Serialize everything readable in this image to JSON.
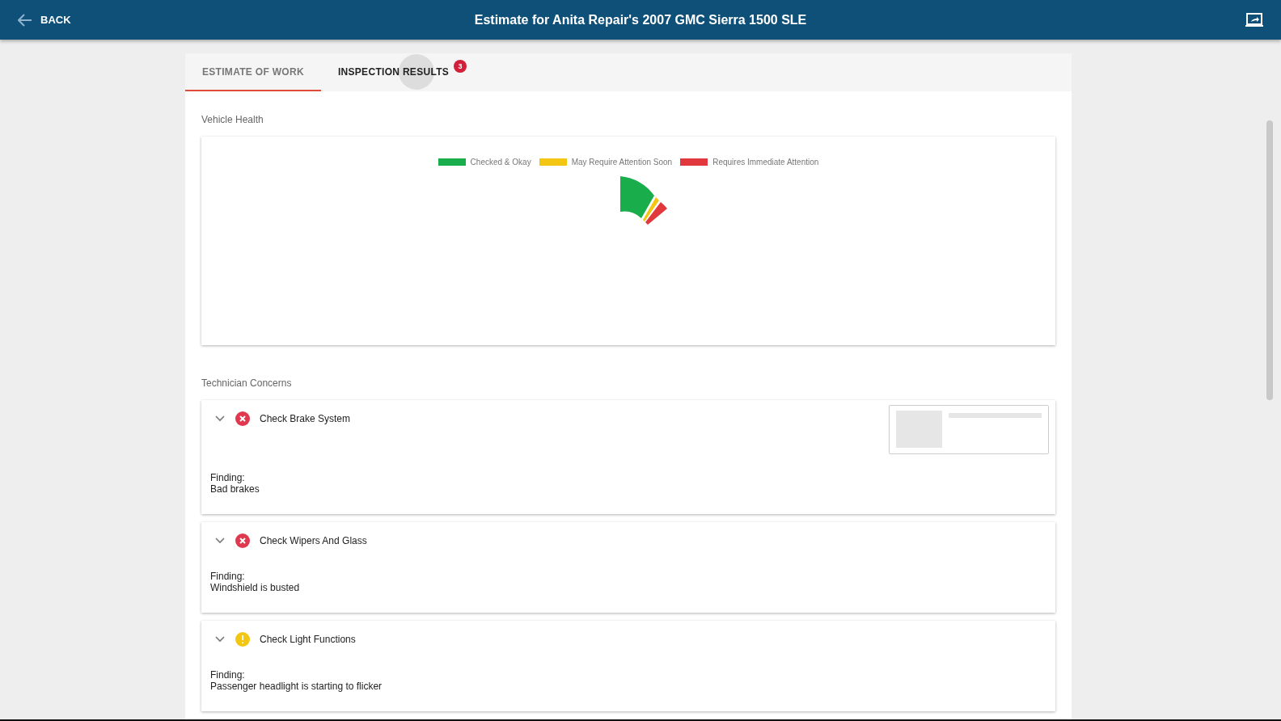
{
  "header": {
    "back_label": "BACK",
    "title": "Estimate for Anita Repair's 2007 GMC Sierra 1500 SLE"
  },
  "tabs": [
    {
      "label": "ESTIMATE OF WORK",
      "selected": true,
      "focused": false
    },
    {
      "label": "INSPECTION RESULTS",
      "selected": false,
      "focused": true,
      "badge": "3"
    }
  ],
  "vehicle_health": {
    "heading": "Vehicle Health",
    "legend": [
      {
        "label": "Checked & Okay",
        "color": "#1aad4b"
      },
      {
        "label": "May Require Attention Soon",
        "color": "#f3c614"
      },
      {
        "label": "Requires Immediate Attention",
        "color": "#e0383c"
      }
    ]
  },
  "technician_concerns": {
    "heading": "Technician Concerns",
    "items": [
      {
        "title": "Check Brake System",
        "kind": "critical",
        "finding_label": "Finding:",
        "finding": "Bad brakes",
        "has_thumbnail": true
      },
      {
        "title": "Check Wipers And Glass",
        "kind": "critical",
        "finding_label": "Finding:",
        "finding": "Windshield is busted",
        "has_thumbnail": false
      },
      {
        "title": "Check Light Functions",
        "kind": "warning",
        "finding_label": "Finding:",
        "finding": "Passenger headlight is starting to flicker",
        "has_thumbnail": false
      }
    ]
  }
}
